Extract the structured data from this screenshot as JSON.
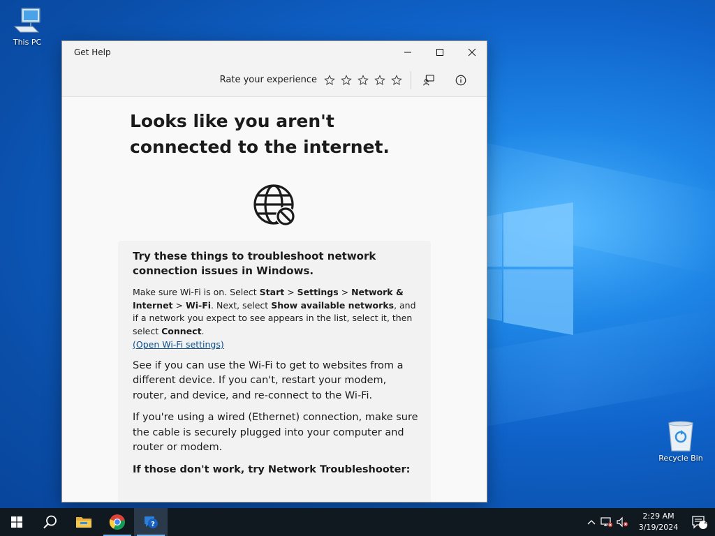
{
  "desktop": {
    "icons": [
      {
        "label": "This PC"
      },
      {
        "label": "Recycle Bin"
      }
    ]
  },
  "window": {
    "title": "Get Help",
    "controls": {
      "minimize": "minimize",
      "maximize": "maximize",
      "close": "close"
    },
    "appbar": {
      "rate_label": "Rate your experience",
      "stars": 5
    },
    "content": {
      "headline": "Looks like you aren't connected to the internet.",
      "card": {
        "title": "Try these things to troubleshoot network connection issues in Windows.",
        "step1": {
          "t1": "Make sure Wi-Fi is on. Select ",
          "b1": "Start",
          "t2": " > ",
          "b2": "Settings",
          "t3": " > ",
          "b3": "Network & Internet",
          "t4": " > ",
          "b4": "Wi-Fi",
          "t5": ". Next, select ",
          "b5": "Show available networks",
          "t6": ", and if a network you expect to see appears in the list, select it, then select ",
          "b6": "Connect",
          "t7": "."
        },
        "link": "(Open Wi-Fi settings)",
        "para2": "See if you can use the Wi-Fi to get to websites from a different device. If you can't, restart your modem, router, and device, and re-connect to the Wi-Fi.",
        "para3": "If you're using a wired (Ethernet) connection, make sure the cable is securely plugged into your computer and router or modem.",
        "para4": "If those don't work, try Network Troubleshooter:"
      }
    }
  },
  "taskbar": {
    "apps": [
      "start-icon",
      "search-icon",
      "file-explorer-icon",
      "chrome-icon",
      "get-help-icon"
    ],
    "clock": {
      "time": "2:29 AM",
      "date": "3/19/2024"
    },
    "notification_count": "2"
  },
  "colors": {
    "link": "#0a4e8c",
    "taskbar": "#101820",
    "accent": "#0f62c9"
  }
}
